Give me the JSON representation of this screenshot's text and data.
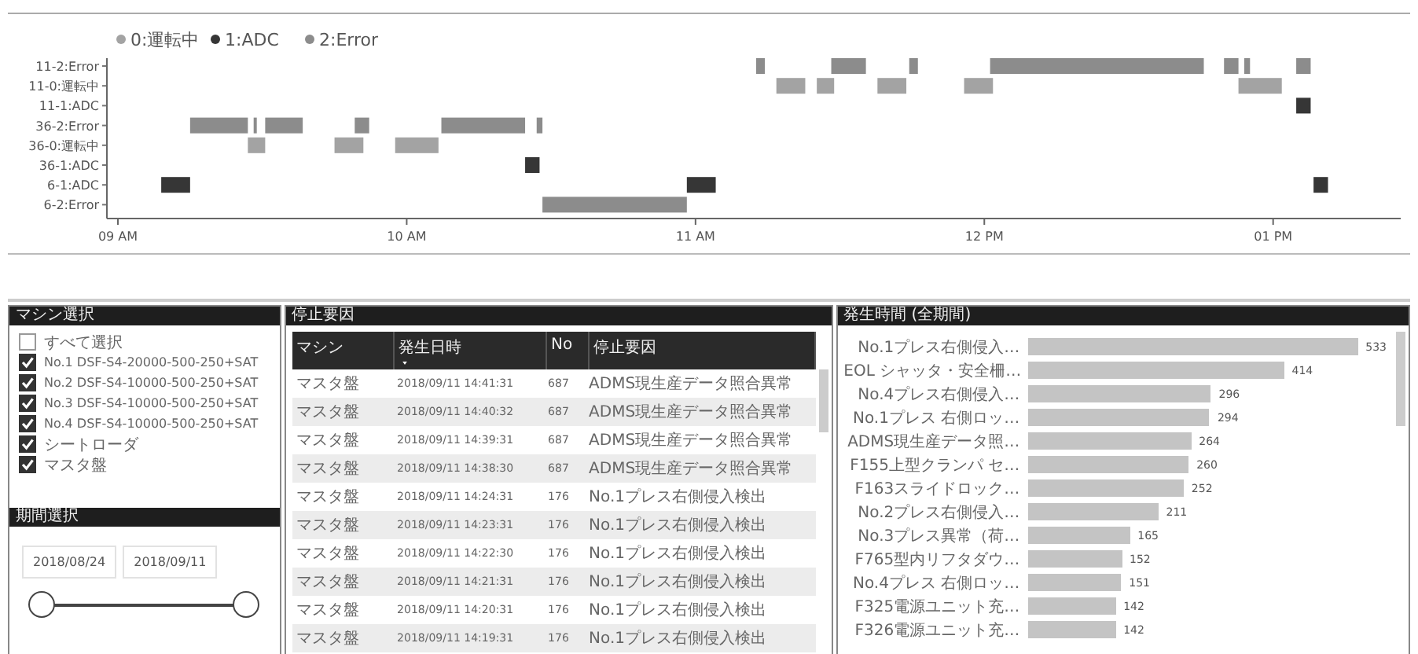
{
  "timeline": {
    "legend": [
      {
        "name": "0:運転中",
        "color": "#a3a3a3"
      },
      {
        "name": "1:ADC",
        "color": "#363636"
      },
      {
        "name": "2:Error",
        "color": "#8c8c8c"
      }
    ],
    "row_labels": [
      "11-2:Error",
      "11-0:運転中",
      "11-1:ADC",
      "36-2:Error",
      "36-0:運転中",
      "36-1:ADC",
      "6-1:ADC",
      "6-2:Error"
    ],
    "x_axis_labels": [
      "09 AM",
      "10 AM",
      "11 AM",
      "12 PM",
      "01 PM"
    ]
  },
  "machine_select": {
    "title": "マシン選択",
    "items": [
      {
        "label": "すべて選択",
        "checked": false
      },
      {
        "label": "No.1 DSF-S4-20000-500-250+SAT",
        "checked": true
      },
      {
        "label": "No.2 DSF-S4-10000-500-250+SAT",
        "checked": true
      },
      {
        "label": "No.3 DSF-S4-10000-500-250+SAT",
        "checked": true
      },
      {
        "label": "No.4 DSF-S4-10000-500-250+SAT",
        "checked": true
      },
      {
        "label": "シートローダ",
        "checked": true
      },
      {
        "label": "マスタ盤",
        "checked": true
      }
    ]
  },
  "period_select": {
    "title": "期間選択",
    "start": "2018/08/24",
    "end": "2018/09/11",
    "slider": {
      "thumbs": [
        {
          "level": 0
        },
        {
          "level": 1
        }
      ]
    }
  },
  "stop_reasons": {
    "title": "停止要因",
    "columns": [
      {
        "label": "マシン",
        "sorted": false
      },
      {
        "label": "発生日時",
        "sorted": true
      },
      {
        "label": "No",
        "sorted": false
      },
      {
        "label": "停止要因",
        "sorted": false
      }
    ],
    "rows": [
      [
        "マスタ盤",
        "2018/09/11 14:41:31",
        "687",
        "ADMS現生産データ照合異常"
      ],
      [
        "マスタ盤",
        "2018/09/11 14:40:32",
        "687",
        "ADMS現生産データ照合異常"
      ],
      [
        "マスタ盤",
        "2018/09/11 14:39:31",
        "687",
        "ADMS現生産データ照合異常"
      ],
      [
        "マスタ盤",
        "2018/09/11 14:38:30",
        "687",
        "ADMS現生産データ照合異常"
      ],
      [
        "マスタ盤",
        "2018/09/11 14:24:31",
        "176",
        "No.1プレス右側侵入検出"
      ],
      [
        "マスタ盤",
        "2018/09/11 14:23:31",
        "176",
        "No.1プレス右側侵入検出"
      ],
      [
        "マスタ盤",
        "2018/09/11 14:22:30",
        "176",
        "No.1プレス右側侵入検出"
      ],
      [
        "マスタ盤",
        "2018/09/11 14:21:31",
        "176",
        "No.1プレス右側侵入検出"
      ],
      [
        "マスタ盤",
        "2018/09/11 14:20:31",
        "176",
        "No.1プレス右側侵入検出"
      ],
      [
        "マスタ盤",
        "2018/09/11 14:19:31",
        "176",
        "No.1プレス右側侵入検出"
      ]
    ]
  },
  "occurrence_time": {
    "title": "発生時間 (全期間)",
    "chart_data": {
      "type": "bar",
      "orientation": "horizontal",
      "data_labels": true,
      "categories": [
        "No.1プレス右側侵入…",
        "EOL シャッタ・安全柵…",
        "No.4プレス右側侵入…",
        "No.1プレス 右側ロッ…",
        "ADMS現生産データ照…",
        "F155上型クランパ セ…",
        "F163スライドロック…",
        "No.2プレス右側侵入…",
        "No.3プレス異常（荷…",
        "F765型内リフタダウ…",
        "No.4プレス 右側ロッ…",
        "F325電源ユニット充…",
        "F326電源ユニット充…"
      ],
      "values": [
        533,
        414,
        296,
        294,
        264,
        260,
        252,
        211,
        165,
        152,
        151,
        142,
        142
      ]
    }
  }
}
